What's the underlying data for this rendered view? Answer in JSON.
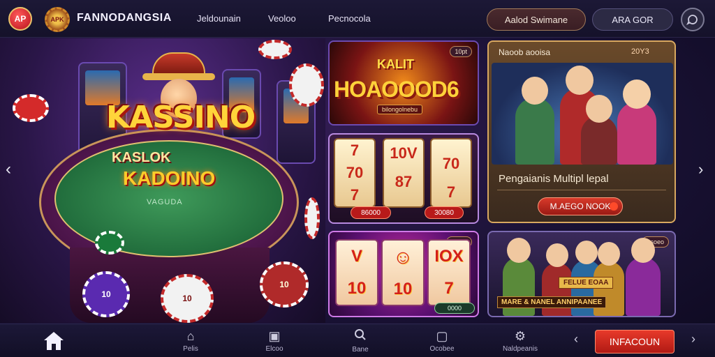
{
  "header": {
    "logo_text": "AP",
    "brand_badge": "APK",
    "brand_name": "FANNODANGSIA",
    "nav": [
      "Jeldounain",
      "Veoloo",
      "Pecnocola"
    ],
    "signup_label": "Aalod Swimane",
    "login_label": "ARA GOR"
  },
  "hero": {
    "title": "KASSINO",
    "table_sub": "KASLOK",
    "table_title": "KADOINO",
    "table_tag": "VAGUDA",
    "chips": [
      "10",
      "10",
      "10"
    ]
  },
  "tiles": {
    "tile1": {
      "tag": "10pt",
      "small": "KALIT",
      "big": "HOAOOOD6",
      "sub": "bilongolnebu"
    },
    "tile2": {
      "reels": [
        [
          "7",
          "70",
          "7"
        ],
        [
          "10V",
          "87",
          ""
        ],
        [
          "",
          "70",
          "7"
        ]
      ],
      "btn1": "86000",
      "btn2": "30080"
    },
    "tile3": {
      "tag": "oroes",
      "reels": [
        [
          "V",
          "10",
          ""
        ],
        [
          "",
          "10",
          ""
        ],
        [
          "IOX",
          "7",
          ""
        ]
      ],
      "btn": "0000"
    },
    "tile4": {
      "tag": "esoeo",
      "banner": "FELUE EOAA",
      "sub": "MARE & NANEL ANNIPAANEE"
    }
  },
  "feature": {
    "heading": "Naoob aooisa",
    "badge": "20Y3",
    "text": "Pengaianis Multipl lepal",
    "button": "M.AEGO NOOK"
  },
  "bottom_nav": {
    "items": [
      {
        "label": "",
        "icon": "home-icon"
      },
      {
        "label": "Pelis",
        "icon": "house-outline-icon"
      },
      {
        "label": "Elcoo",
        "icon": "square-icon"
      },
      {
        "label": "Bane",
        "icon": "search-icon"
      },
      {
        "label": "Ocobee",
        "icon": "window-icon"
      },
      {
        "label": "Naldpeanis",
        "icon": "gear-icon"
      }
    ],
    "cta": "INFACOUN"
  }
}
